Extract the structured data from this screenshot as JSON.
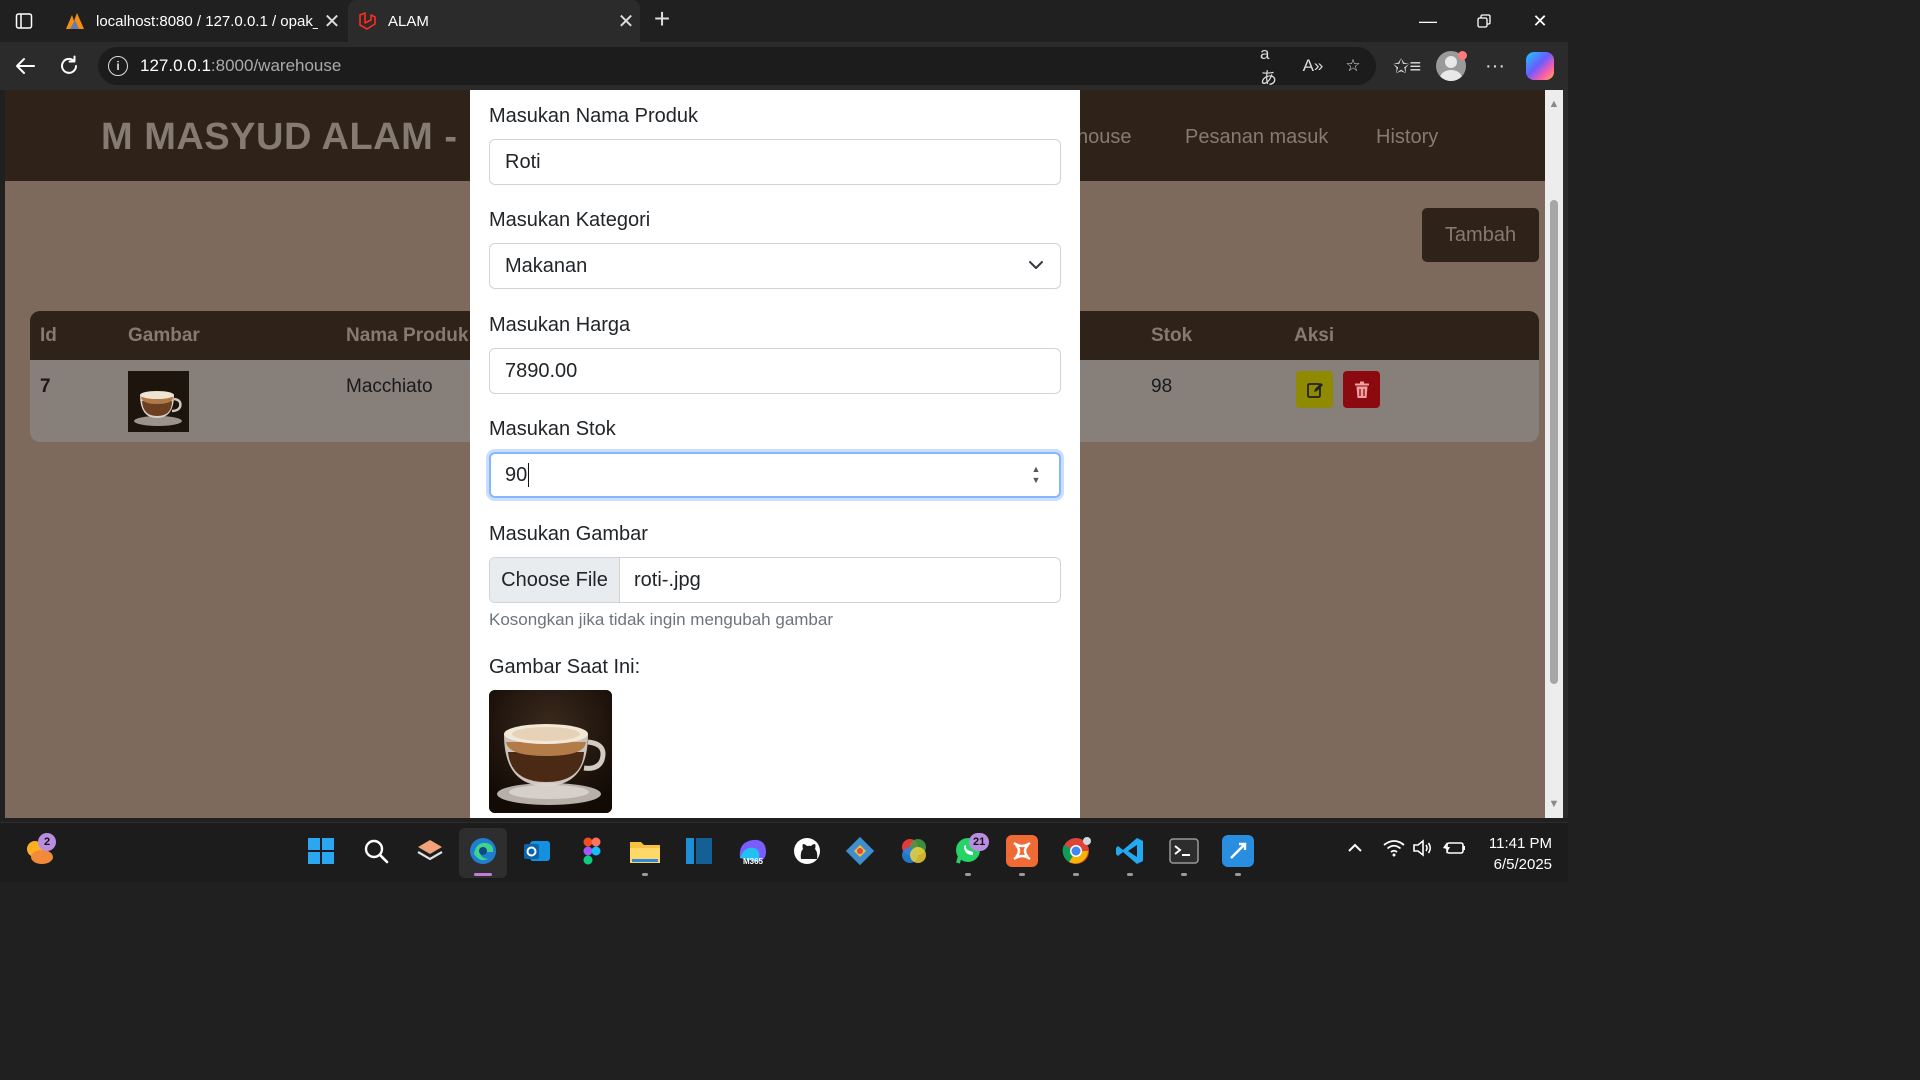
{
  "browser": {
    "tabs": [
      {
        "title": "localhost:8080 / 127.0.0.1 / opak_",
        "active": false
      },
      {
        "title": "ALAM",
        "active": true
      }
    ],
    "url_host": "127.0.0.1",
    "url_path": ":8000/warehouse"
  },
  "site": {
    "brand": "M MASYUD ALAM -",
    "nav": [
      "house",
      "Pesanan masuk",
      "History"
    ],
    "add_button": "Tambah"
  },
  "table": {
    "headers": [
      "Id",
      "Gambar",
      "Nama Produk",
      "Stok",
      "Aksi"
    ],
    "rows": [
      {
        "id": "7",
        "name": "Macchiato",
        "stock": "98"
      }
    ]
  },
  "modal": {
    "name_label": "Masukan Nama Produk",
    "name_value": "Roti",
    "category_label": "Masukan Kategori",
    "category_value": "Makanan",
    "price_label": "Masukan Harga",
    "price_value": "7890.00",
    "stock_label": "Masukan Stok",
    "stock_value": "90",
    "image_label": "Masukan Gambar",
    "file_button": "Choose File",
    "file_name": "roti-.jpg",
    "help_text": "Kosongkan jika tidak ingin mengubah gambar",
    "current_image_label": "Gambar Saat Ini:"
  },
  "taskbar": {
    "weather_badge": "2",
    "whatsapp_badge": "21",
    "m365_label": "M365",
    "time": "11:41 PM",
    "date": "6/5/2025"
  }
}
